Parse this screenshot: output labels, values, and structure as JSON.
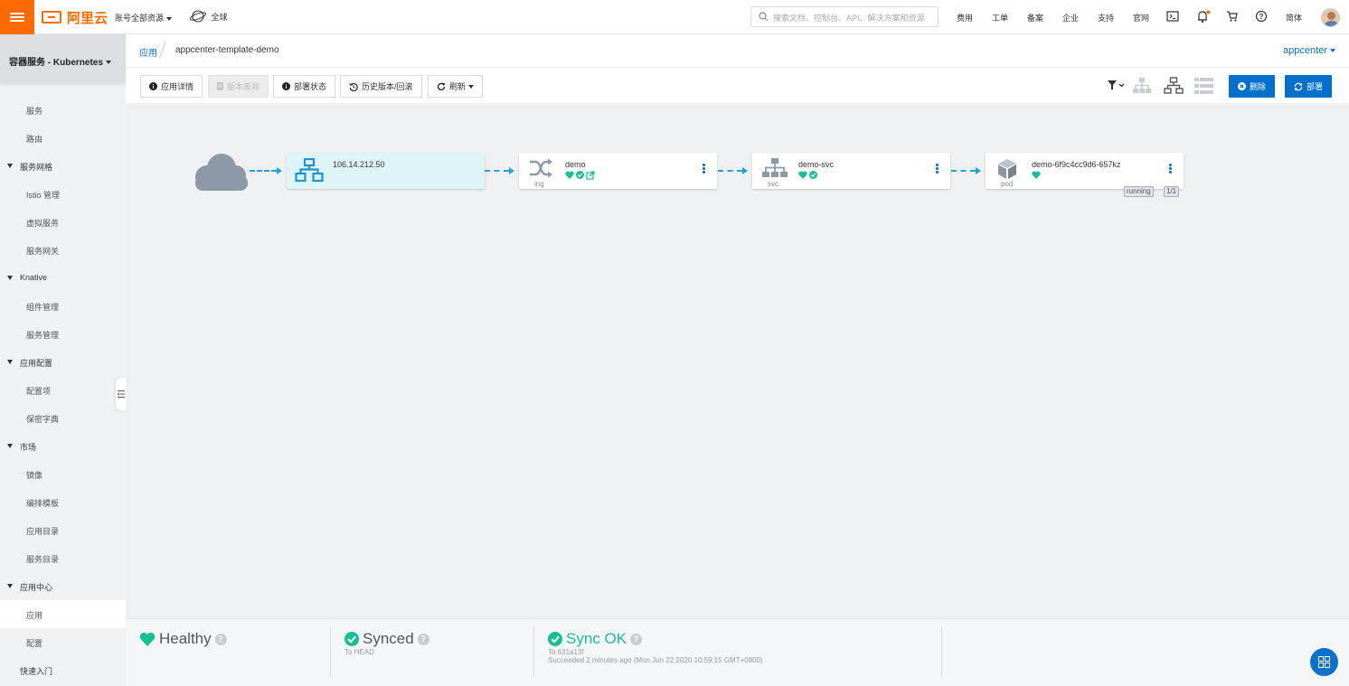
{
  "topbar": {
    "brand": "阿里云",
    "account_scope": "账号全部资源",
    "region": "全球",
    "search_placeholder": "搜索文档、控制台、API、解决方案和资源",
    "nav": [
      "费用",
      "工单",
      "备案",
      "企业",
      "支持",
      "官网"
    ],
    "lang": "简体"
  },
  "sidebar": {
    "product": "容器服务 - Kubernetes",
    "items": [
      {
        "label": "服务",
        "level": "child"
      },
      {
        "label": "路由",
        "level": "child"
      },
      {
        "label": "服务网格",
        "level": "group"
      },
      {
        "label": "Istio 管理",
        "level": "child"
      },
      {
        "label": "虚拟服务",
        "level": "child"
      },
      {
        "label": "服务网关",
        "level": "child"
      },
      {
        "label": "Knative",
        "level": "group"
      },
      {
        "label": "组件管理",
        "level": "child"
      },
      {
        "label": "服务管理",
        "level": "child"
      },
      {
        "label": "应用配置",
        "level": "group"
      },
      {
        "label": "配置项",
        "level": "child"
      },
      {
        "label": "保密字典",
        "level": "child"
      },
      {
        "label": "市场",
        "level": "group"
      },
      {
        "label": "镜像",
        "level": "child"
      },
      {
        "label": "编排模板",
        "level": "child"
      },
      {
        "label": "应用目录",
        "level": "child"
      },
      {
        "label": "服务目录",
        "level": "child"
      },
      {
        "label": "应用中心",
        "level": "group"
      },
      {
        "label": "应用",
        "level": "child",
        "active": true
      },
      {
        "label": "配置",
        "level": "child"
      },
      {
        "label": "快速入门",
        "level": "top"
      }
    ]
  },
  "breadcrumb": {
    "parent": "应用",
    "current": "appcenter-template-demo",
    "namespace": "appcenter"
  },
  "toolbar": {
    "app_details": "应用详情",
    "version_diff": "版本差异",
    "deploy_status": "部署状态",
    "history": "历史版本/回滚",
    "refresh": "刷新",
    "delete": "删除",
    "deploy": "部署"
  },
  "graph": {
    "nodes": [
      {
        "name": "106.14.212.50",
        "kind": "",
        "type": "loadbalancer"
      },
      {
        "name": "demo",
        "kind": "ing",
        "type": "ingress"
      },
      {
        "name": "demo-svc",
        "kind": "svc",
        "type": "service"
      },
      {
        "name": "demo-6f9c4cc9d6-657kz",
        "kind": "pod",
        "type": "pod",
        "tags": [
          "running",
          "1/1"
        ]
      }
    ]
  },
  "status": {
    "health": "Healthy",
    "sync": "Synced",
    "sync_sub": "To HEAD",
    "op": "Sync OK",
    "op_sub1": "To 631a13f",
    "op_sub2": "Succeeded 2 minutes ago (Mon Jun 22 2020 10:59:15 GMT+0800)"
  },
  "colors": {
    "brand_orange": "#ff6a00",
    "primary_blue": "#0070cc",
    "healthy_green": "#18be94",
    "edge_blue": "#24a1d6"
  }
}
